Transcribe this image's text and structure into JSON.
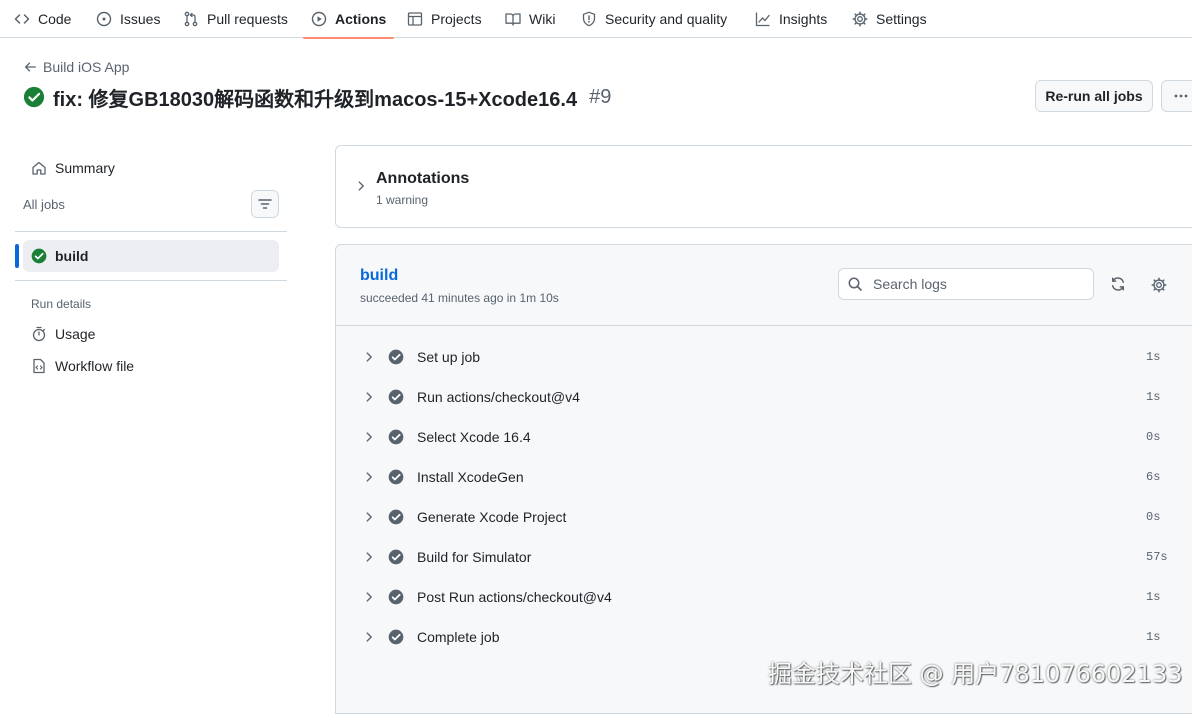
{
  "repo_nav": {
    "items": [
      {
        "label": "Code",
        "icon": "code-icon"
      },
      {
        "label": "Issues",
        "icon": "issue-opened-icon"
      },
      {
        "label": "Pull requests",
        "icon": "git-pull-request-icon"
      },
      {
        "label": "Actions",
        "icon": "play-icon",
        "active": true
      },
      {
        "label": "Projects",
        "icon": "table-icon"
      },
      {
        "label": "Wiki",
        "icon": "book-icon"
      },
      {
        "label": "Security and quality",
        "icon": "shield-icon"
      },
      {
        "label": "Insights",
        "icon": "graph-icon"
      },
      {
        "label": "Settings",
        "icon": "gear-icon"
      }
    ]
  },
  "header": {
    "back_label": "Build iOS App",
    "run_title": "fix: 修复GB18030解码函数和升级到macos-15+Xcode16.4",
    "run_number": "#9",
    "status": "success",
    "rerun_label": "Re-run all jobs",
    "more_label": "···"
  },
  "sidebar": {
    "summary_label": "Summary",
    "all_jobs_label": "All jobs",
    "jobs": [
      {
        "label": "build",
        "status": "success",
        "selected": true
      }
    ],
    "run_details_label": "Run details",
    "details": [
      {
        "label": "Usage",
        "icon": "stopwatch-icon"
      },
      {
        "label": "Workflow file",
        "icon": "file-code-icon"
      }
    ]
  },
  "annotations": {
    "title": "Annotations",
    "subtitle": "1 warning"
  },
  "job": {
    "name": "build",
    "status_text": "succeeded 41 minutes ago in 1m 10s",
    "search_placeholder": "Search logs",
    "steps": [
      {
        "name": "Set up job",
        "duration": "1s"
      },
      {
        "name": "Run actions/checkout@v4",
        "duration": "1s"
      },
      {
        "name": "Select Xcode 16.4",
        "duration": "0s"
      },
      {
        "name": "Install XcodeGen",
        "duration": "6s"
      },
      {
        "name": "Generate Xcode Project",
        "duration": "0s"
      },
      {
        "name": "Build for Simulator",
        "duration": "57s"
      },
      {
        "name": "Post Run actions/checkout@v4",
        "duration": "1s"
      },
      {
        "name": "Complete job",
        "duration": "1s"
      }
    ]
  },
  "watermark": "掘金技术社区 @ 用户781076602133",
  "colors": {
    "success": "#1a7f37",
    "link": "#0969da",
    "active_underline": "#fd8c73",
    "step_check": "#59636e"
  }
}
